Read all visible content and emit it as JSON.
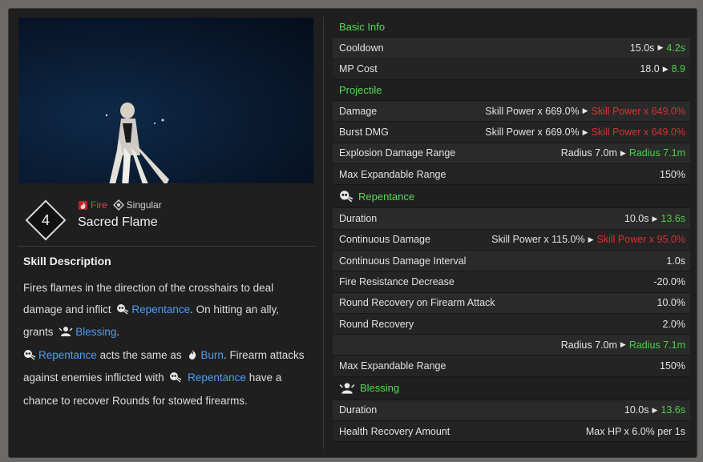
{
  "skill": {
    "level": "4",
    "element": "Fire",
    "type": "Singular",
    "name": "Sacred Flame"
  },
  "description": {
    "title": "Skill Description",
    "p1_a": "Fires flames in the direction of the crosshairs to deal damage and inflict",
    "kw_repentance": "Repentance",
    "p1_b": ". On hitting an ally, grants",
    "kw_blessing": "Blessing",
    "p1_c": ".",
    "p2_a": "acts the same as",
    "kw_burn": "Burn",
    "p2_b": ". Firearm attacks against enemies inflicted with",
    "p2_c": "have a chance to recover Rounds for stowed firearms."
  },
  "sections": {
    "basic": "Basic Info",
    "projectile": "Projectile",
    "repentance": "Repentance",
    "blessing": "Blessing"
  },
  "stats": {
    "cooldown": {
      "label": "Cooldown",
      "old": "15.0s",
      "new": "4.2s"
    },
    "mp": {
      "label": "MP Cost",
      "old": "18.0",
      "new": "8.9"
    },
    "damage": {
      "label": "Damage",
      "old": "Skill Power x 669.0%",
      "new": "Skill Power x 649.0%"
    },
    "burst": {
      "label": "Burst DMG",
      "old": "Skill Power x 669.0%",
      "new": "Skill Power x 649.0%"
    },
    "explosion": {
      "label": "Explosion Damage Range",
      "old": "Radius 7.0m",
      "new": "Radius 7.1m"
    },
    "maxexp1": {
      "label": "Max Expandable Range",
      "value": "150%"
    },
    "rep_duration": {
      "label": "Duration",
      "old": "10.0s",
      "new": "13.6s"
    },
    "cont_damage": {
      "label": "Continuous Damage",
      "old": "Skill Power x 115.0%",
      "new": "Skill Power x 95.0%"
    },
    "cont_interval": {
      "label": "Continuous Damage Interval",
      "value": "1.0s"
    },
    "fire_res": {
      "label": "Fire Resistance Decrease",
      "value": "-20.0%"
    },
    "round_rec_fa": {
      "label": "Round Recovery on Firearm Attack",
      "value": "10.0%"
    },
    "round_rec": {
      "label": "Round Recovery",
      "value": "2.0%"
    },
    "radius2": {
      "old": "Radius 7.0m",
      "new": "Radius 7.1m"
    },
    "maxexp2": {
      "label": "Max Expandable Range",
      "value": "150%"
    },
    "bless_duration": {
      "label": "Duration",
      "old": "10.0s",
      "new": "13.6s"
    },
    "health_rec": {
      "label": "Health Recovery Amount",
      "value": "Max HP x 6.0% per 1s"
    }
  },
  "colors": {
    "up": "#49d049",
    "down": "#d83030",
    "keyword": "#4f9ef2",
    "section": "#58d858"
  }
}
